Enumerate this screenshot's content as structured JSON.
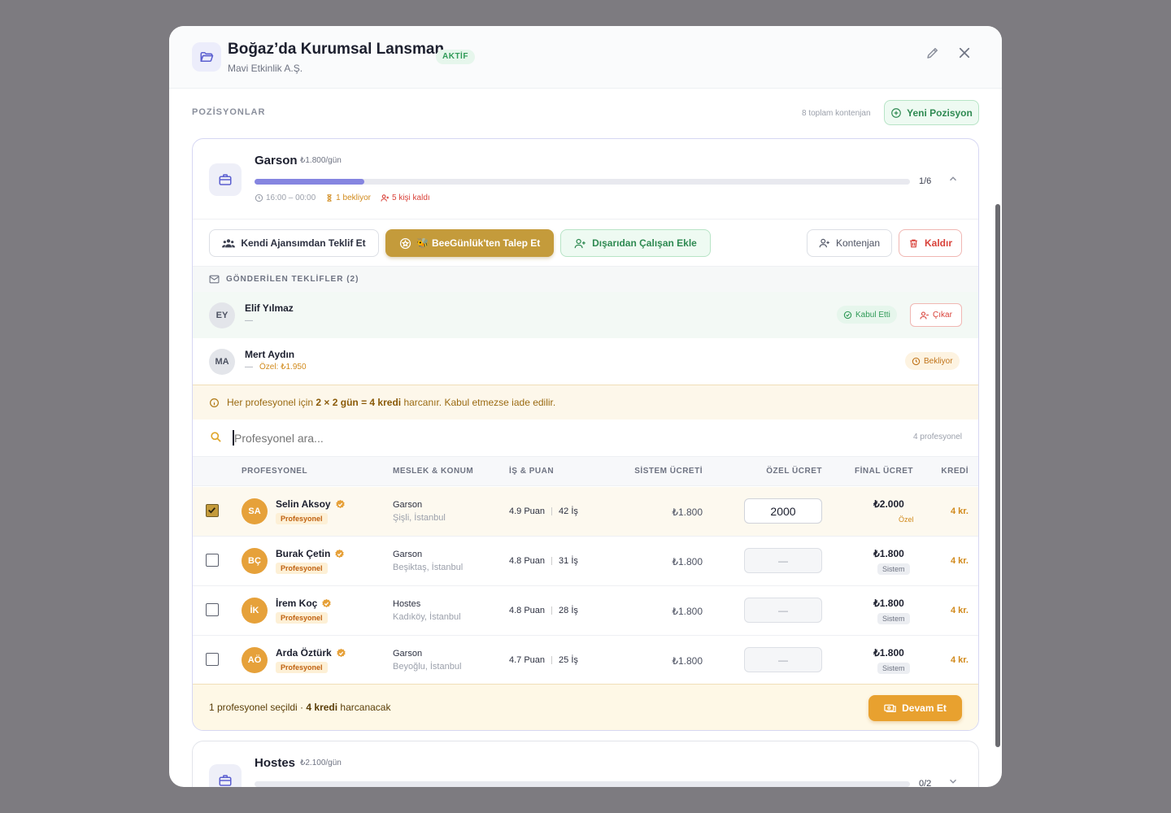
{
  "header": {
    "title": "Boğaz’da Kurumsal Lansman",
    "status": "AKTİF",
    "company": "Mavi Etkinlik A.Ş."
  },
  "section": {
    "label": "POZİSYONLAR",
    "total": "8 toplam kontenjan",
    "new_position": "Yeni Pozisyon"
  },
  "position1": {
    "name": "Garson",
    "rate": "₺1.800/gün",
    "count": "1/6",
    "fill": 0.167,
    "time": "16:00 – 00:00",
    "waiting": "1 bekliyor",
    "remaining": "5 kişi kaldı"
  },
  "actions": {
    "own_agency": "Kendi Ajansımdan Teklif Et",
    "request": "🐝 BeeGünlük'ten Talep Et",
    "external": "Dışarıdan Çalışan Ekle",
    "quota": "Kontenjan",
    "remove": "Kaldır"
  },
  "sent_offers": {
    "heading": "GÖNDERİLEN TEKLİFLER (2)",
    "items": [
      {
        "initials": "EY",
        "name": "Elif Yılmaz",
        "detail": "—",
        "status": "Kabul Etti",
        "action": "Çıkar"
      },
      {
        "initials": "MA",
        "name": "Mert Aydın",
        "detail": "—",
        "special": "Özel: ₺1.950",
        "status": "Bekliyor"
      }
    ]
  },
  "notice": {
    "pre": "Her profesyonel için ",
    "bold": "2 × 2 gün = 4 kredi",
    "post": " harcanır. Kabul etmezse iade edilir."
  },
  "search": {
    "placeholder": "Profesyonel ara...",
    "count": "4 profesyonel"
  },
  "table": {
    "headers": [
      "PROFESYONEL",
      "MESLEK & KONUM",
      "İŞ & PUAN",
      "SİSTEM ÜCRETİ",
      "ÖZEL ÜCRET",
      "FİNAL ÜCRET",
      "KREDİ"
    ],
    "rows": [
      {
        "initials": "SA",
        "name": "Selin Aksoy",
        "badge": "Profesyonel",
        "job": "Garson",
        "location": "Şişli, İstanbul",
        "score": "4.9 Puan",
        "jobs": "42 İş",
        "system": "₺1.800",
        "custom": "2000",
        "final": "₺2.000",
        "tag": "Özel",
        "credit": "4 kr.",
        "checked": true
      },
      {
        "initials": "BÇ",
        "name": "Burak Çetin",
        "badge": "Profesyonel",
        "job": "Garson",
        "location": "Beşiktaş, İstanbul",
        "score": "4.8 Puan",
        "jobs": "31 İş",
        "system": "₺1.800",
        "custom": "—",
        "final": "₺1.800",
        "tag": "Sistem",
        "credit": "4 kr.",
        "checked": false
      },
      {
        "initials": "İK",
        "name": "İrem Koç",
        "badge": "Profesyonel",
        "job": "Hostes",
        "location": "Kadıköy, İstanbul",
        "score": "4.8 Puan",
        "jobs": "28 İş",
        "system": "₺1.800",
        "custom": "—",
        "final": "₺1.800",
        "tag": "Sistem",
        "credit": "4 kr.",
        "checked": false
      },
      {
        "initials": "AÖ",
        "name": "Arda Öztürk",
        "badge": "Profesyonel",
        "job": "Garson",
        "location": "Beyoğlu, İstanbul",
        "score": "4.7 Puan",
        "jobs": "25 İş",
        "system": "₺1.800",
        "custom": "—",
        "final": "₺1.800",
        "tag": "Sistem",
        "credit": "4 kr.",
        "checked": false
      }
    ]
  },
  "footer": {
    "pre": "1 profesyonel seçildi · ",
    "bold": "4 kredi",
    "post": " harcanacak",
    "button": "Devam Et"
  },
  "position2": {
    "name": "Hostes",
    "rate": "₺2.100/gün",
    "count": "0/2"
  },
  "colors": {
    "accent": "#8585e0",
    "gold": "#c49b3b",
    "green": "#2f9a57",
    "red": "#d9423a",
    "orange": "#e6a13a"
  }
}
